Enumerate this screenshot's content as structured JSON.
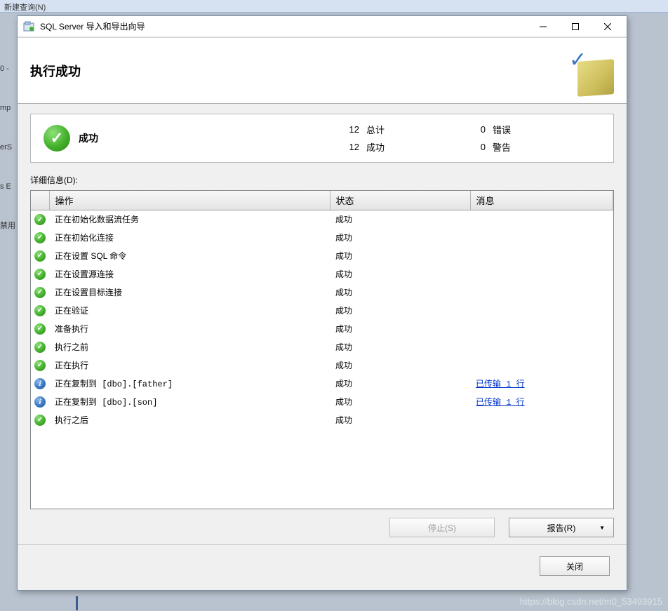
{
  "background": {
    "top_fragment": "新建查询(N)",
    "left_fragments": [
      "0 -",
      "mp",
      "erS",
      "s E",
      "禁用"
    ]
  },
  "titlebar": {
    "title": "SQL Server 导入和导出向导"
  },
  "header": {
    "heading": "执行成功"
  },
  "summary": {
    "status_label": "成功",
    "total_count": "12",
    "total_label": "总计",
    "error_count": "0",
    "error_label": "错误",
    "success_count": "12",
    "success_label": "成功",
    "warn_count": "0",
    "warn_label": "警告"
  },
  "details_label": "详细信息(D):",
  "table": {
    "headers": {
      "icon": "",
      "operation": "操作",
      "status": "状态",
      "message": "消息"
    },
    "rows": [
      {
        "icon": "success",
        "operation": "正在初始化数据流任务",
        "status": "成功",
        "message": "",
        "link": false
      },
      {
        "icon": "success",
        "operation": "正在初始化连接",
        "status": "成功",
        "message": "",
        "link": false
      },
      {
        "icon": "success",
        "operation": "正在设置 SQL 命令",
        "status": "成功",
        "message": "",
        "link": false
      },
      {
        "icon": "success",
        "operation": "正在设置源连接",
        "status": "成功",
        "message": "",
        "link": false
      },
      {
        "icon": "success",
        "operation": "正在设置目标连接",
        "status": "成功",
        "message": "",
        "link": false
      },
      {
        "icon": "success",
        "operation": "正在验证",
        "status": "成功",
        "message": "",
        "link": false
      },
      {
        "icon": "success",
        "operation": "准备执行",
        "status": "成功",
        "message": "",
        "link": false
      },
      {
        "icon": "success",
        "operation": "执行之前",
        "status": "成功",
        "message": "",
        "link": false
      },
      {
        "icon": "success",
        "operation": "正在执行",
        "status": "成功",
        "message": "",
        "link": false
      },
      {
        "icon": "info",
        "operation": "正在复制到 [dbo].[father]",
        "status": "成功",
        "message": "已传输 1 行",
        "link": true
      },
      {
        "icon": "info",
        "operation": "正在复制到 [dbo].[son]",
        "status": "成功",
        "message": "已传输 1 行",
        "link": true
      },
      {
        "icon": "success",
        "operation": "执行之后",
        "status": "成功",
        "message": "",
        "link": false
      }
    ]
  },
  "buttons": {
    "stop": "停止(S)",
    "report": "报告(R)",
    "close": "关闭"
  },
  "watermark": "https://blog.csdn.net/m0_53493915"
}
